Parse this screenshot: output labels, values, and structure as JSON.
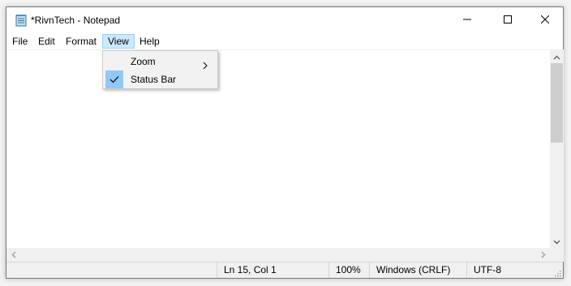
{
  "window": {
    "title": "*RivnTech - Notepad"
  },
  "menubar": {
    "items": [
      "File",
      "Edit",
      "Format",
      "View",
      "Help"
    ],
    "selected": "View"
  },
  "view_menu": {
    "items": [
      {
        "label": "Zoom",
        "has_submenu": true,
        "checked": false
      },
      {
        "label": "Status Bar",
        "has_submenu": false,
        "checked": true
      }
    ]
  },
  "editor": {
    "content": ""
  },
  "statusbar": {
    "position": "Ln 15, Col 1",
    "zoom": "100%",
    "line_ending": "Windows (CRLF)",
    "encoding": "UTF-8"
  },
  "icons": {
    "app": "notepad-icon",
    "minimize": "minimize-icon",
    "maximize": "maximize-icon",
    "close": "close-icon",
    "check": "checkmark-icon",
    "submenu": "chevron-right-icon"
  },
  "colors": {
    "menu_highlight": "#cce8ff",
    "check_background": "#90c8f6"
  }
}
